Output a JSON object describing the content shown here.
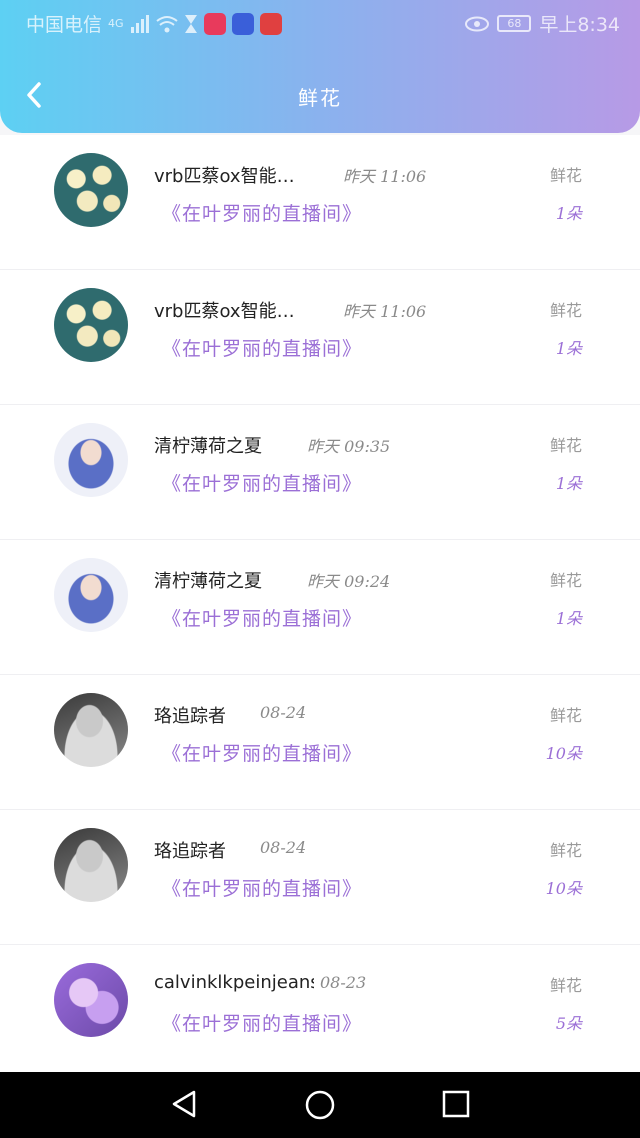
{
  "status_bar": {
    "carrier": "中国电信",
    "network": "4G",
    "battery": "68",
    "time": "早上8:34"
  },
  "header": {
    "title": "鲜花"
  },
  "icons": {
    "back": "chevron-left-icon",
    "eye": "eye-icon",
    "wifi": "wifi-icon",
    "hourglass": "hourglass-icon",
    "nav_back": "triangle-back-icon",
    "nav_home": "circle-home-icon",
    "nav_recent": "square-recent-icon"
  },
  "colors": {
    "accent": "#9b6fd6",
    "header_start": "#5dd0f3",
    "header_end": "#b79ae6"
  },
  "records": [
    {
      "name": "vrb匹蔡ox智能…",
      "time": "昨天  11:06",
      "room": "《在叶罗丽的直播间》",
      "gift": "鲜花",
      "count": "1朵"
    },
    {
      "name": "vrb匹蔡ox智能…",
      "time": "昨天  11:06",
      "room": "《在叶罗丽的直播间》",
      "gift": "鲜花",
      "count": "1朵"
    },
    {
      "name": "清柠薄荷之夏",
      "time": "昨天  09:35",
      "room": "《在叶罗丽的直播间》",
      "gift": "鲜花",
      "count": "1朵"
    },
    {
      "name": "清柠薄荷之夏",
      "time": "昨天  09:24",
      "room": "《在叶罗丽的直播间》",
      "gift": "鲜花",
      "count": "1朵"
    },
    {
      "name": "珞追踪者",
      "time": "08-24",
      "room": "《在叶罗丽的直播间》",
      "gift": "鲜花",
      "count": "10朵"
    },
    {
      "name": "珞追踪者",
      "time": "08-24",
      "room": "《在叶罗丽的直播间》",
      "gift": "鲜花",
      "count": "10朵"
    },
    {
      "name": "calvinklkpeinjeans",
      "time": "08-23",
      "room": "《在叶罗丽的直播间》",
      "gift": "鲜花",
      "count": "5朵"
    }
  ]
}
